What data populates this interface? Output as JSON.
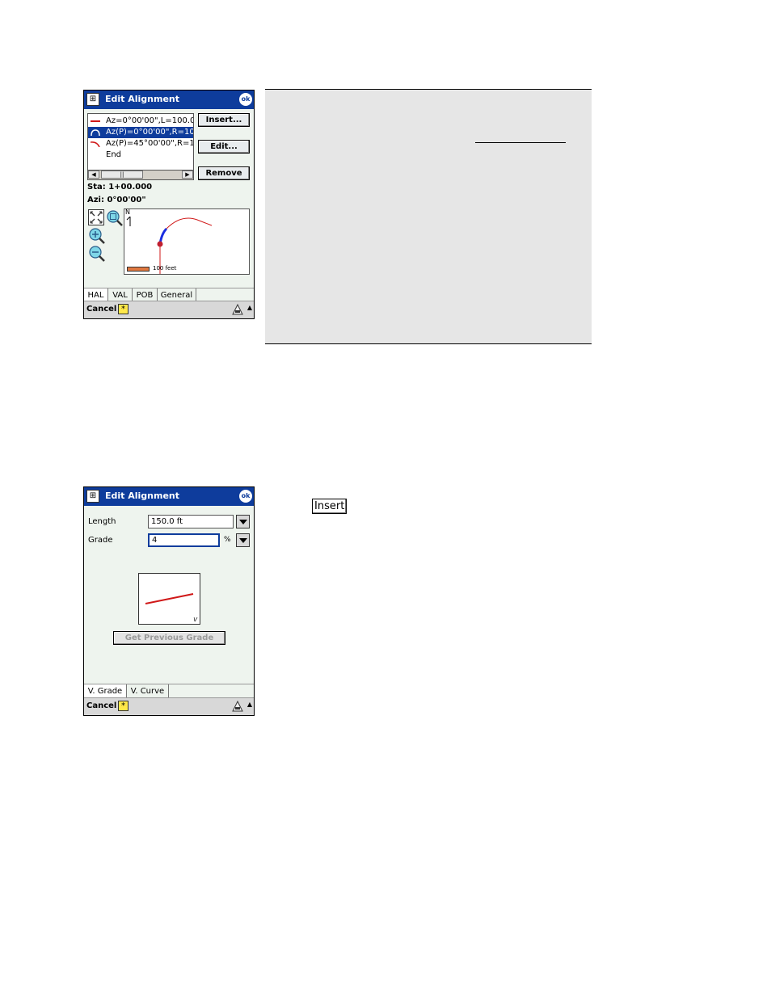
{
  "screen1": {
    "title": "Edit Alignment",
    "ok_label": "ok",
    "list_items": [
      {
        "text": "Az=0°00'00\",L=100.0",
        "selected": false,
        "symbol": "line"
      },
      {
        "text": "Az(P)=0°00'00\",R=10",
        "selected": true,
        "symbol": "arc"
      },
      {
        "text": "Az(P)=45°00'00\",R=1",
        "selected": false,
        "symbol": "curve"
      },
      {
        "text": "End",
        "selected": false,
        "symbol": "none"
      }
    ],
    "buttons": {
      "insert": "Insert...",
      "edit": "Edit...",
      "remove": "Remove"
    },
    "station": "Sta: 1+00.000",
    "azimuth": "Azi: 0°00'00\"",
    "north_label": "N",
    "scale_label": "100 feet",
    "tabs": [
      "HAL",
      "VAL",
      "POB",
      "General"
    ],
    "active_tab": "HAL",
    "cancel_label": "Cancel",
    "star_label": "*"
  },
  "screen2": {
    "title": "Edit Alignment",
    "ok_label": "ok",
    "length_label": "Length",
    "length_value": "150.0 ft",
    "grade_label": "Grade",
    "grade_value": "4",
    "grade_unit": "%",
    "preview_label": "V",
    "get_previous_grade": "Get Previous Grade",
    "tabs": [
      "V. Grade",
      "V. Curve"
    ],
    "active_tab": "V. Grade",
    "cancel_label": "Cancel",
    "star_label": "*"
  },
  "insert_button_label": "Insert",
  "colors": {
    "titlebar": "#0e3c9c",
    "curve": "#d01818",
    "selected": "#0e3c9c",
    "scale_bar": "#e07840"
  }
}
